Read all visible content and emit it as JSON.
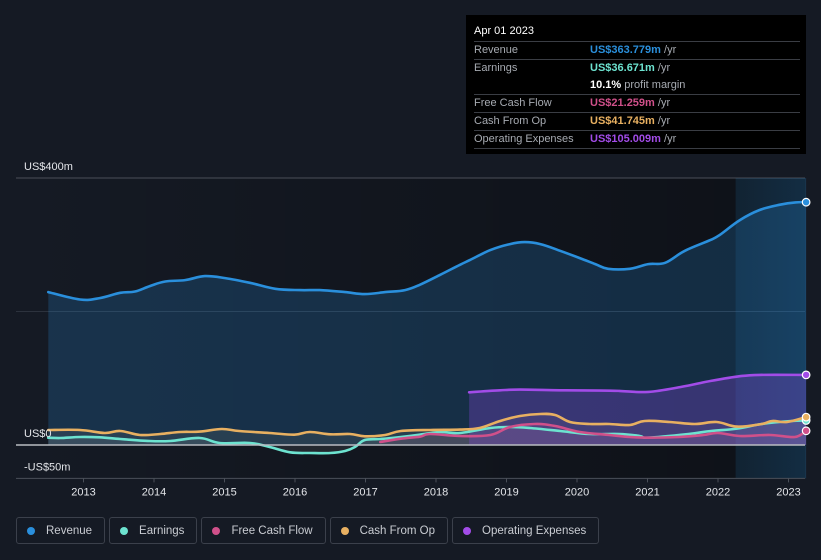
{
  "tooltip": {
    "date": "Apr 01 2023",
    "rows": [
      {
        "label": "Revenue",
        "value": "US$363.779m",
        "unit": "/yr",
        "color": "#2a8fdc"
      },
      {
        "label": "Earnings",
        "value": "US$36.671m",
        "unit": "/yr",
        "color": "#6de3d0"
      },
      {
        "label": "",
        "value": "10.1%",
        "unit": "profit margin",
        "color": "#ffffff"
      },
      {
        "label": "Free Cash Flow",
        "value": "US$21.259m",
        "unit": "/yr",
        "color": "#d0508a"
      },
      {
        "label": "Cash From Op",
        "value": "US$41.745m",
        "unit": "/yr",
        "color": "#e8b061"
      },
      {
        "label": "Operating Expenses",
        "value": "US$105.009m",
        "unit": "/yr",
        "color": "#a24ce8"
      }
    ]
  },
  "legend": [
    {
      "label": "Revenue",
      "color": "#2a8fdc"
    },
    {
      "label": "Earnings",
      "color": "#6de3d0"
    },
    {
      "label": "Free Cash Flow",
      "color": "#d0508a"
    },
    {
      "label": "Cash From Op",
      "color": "#e8b061"
    },
    {
      "label": "Operating Expenses",
      "color": "#a24ce8"
    }
  ],
  "chart_data": {
    "type": "area",
    "title": "",
    "xlabel": "",
    "ylabel": "",
    "ylim": [
      -50,
      400
    ],
    "xlim": [
      2012.3,
      2023.25
    ],
    "y_tick_labels": [
      {
        "value": 400,
        "label": "US$400m"
      },
      {
        "value": 0,
        "label": "US$0"
      },
      {
        "value": -50,
        "label": "-US$50m"
      }
    ],
    "gridlines_at": [
      400,
      200
    ],
    "x_ticks": [
      2013,
      2014,
      2015,
      2016,
      2017,
      2018,
      2019,
      2020,
      2021,
      2022,
      2023
    ],
    "x_tick_labels": [
      "2013",
      "2014",
      "2015",
      "2016",
      "2017",
      "2018",
      "2019",
      "2020",
      "2021",
      "2022",
      "2023"
    ],
    "highlight_range": [
      2022.25,
      2023.25
    ],
    "legend_position": "bottom-left",
    "units": "US$ millions per year",
    "series": [
      {
        "name": "Revenue",
        "color": "#2a8fdc",
        "points": [
          [
            2012.5,
            229
          ],
          [
            2012.95,
            218
          ],
          [
            2013.23,
            220
          ],
          [
            2013.52,
            228
          ],
          [
            2013.73,
            230
          ],
          [
            2013.94,
            238
          ],
          [
            2014.16,
            245
          ],
          [
            2014.44,
            247
          ],
          [
            2014.72,
            253
          ],
          [
            2015.01,
            250
          ],
          [
            2015.36,
            243
          ],
          [
            2015.72,
            234
          ],
          [
            2016.07,
            232
          ],
          [
            2016.35,
            232
          ],
          [
            2016.71,
            229
          ],
          [
            2016.99,
            226
          ],
          [
            2017.28,
            229
          ],
          [
            2017.56,
            232
          ],
          [
            2017.77,
            240
          ],
          [
            2018.06,
            255
          ],
          [
            2018.34,
            270
          ],
          [
            2018.48,
            277
          ],
          [
            2018.77,
            292
          ],
          [
            2019.05,
            301
          ],
          [
            2019.26,
            304
          ],
          [
            2019.48,
            301
          ],
          [
            2019.76,
            291
          ],
          [
            2020.04,
            280
          ],
          [
            2020.26,
            271
          ],
          [
            2020.44,
            264
          ],
          [
            2020.75,
            264
          ],
          [
            2021.01,
            271
          ],
          [
            2021.25,
            273
          ],
          [
            2021.53,
            291
          ],
          [
            2021.89,
            307
          ],
          [
            2022.03,
            315
          ],
          [
            2022.31,
            337
          ],
          [
            2022.59,
            352
          ],
          [
            2022.88,
            360
          ],
          [
            2023.1,
            363.5
          ],
          [
            2023.25,
            363.779
          ]
        ]
      },
      {
        "name": "Earnings",
        "color": "#6de3d0",
        "points": [
          [
            2012.5,
            11
          ],
          [
            2012.67,
            10.5
          ],
          [
            2012.95,
            12
          ],
          [
            2013.23,
            11.5
          ],
          [
            2013.52,
            9
          ],
          [
            2013.94,
            6
          ],
          [
            2014.23,
            6
          ],
          [
            2014.65,
            10.5
          ],
          [
            2014.93,
            3
          ],
          [
            2015.36,
            3
          ],
          [
            2015.64,
            -3
          ],
          [
            2015.93,
            -11
          ],
          [
            2016.21,
            -12
          ],
          [
            2016.5,
            -12
          ],
          [
            2016.71,
            -9
          ],
          [
            2016.85,
            -3
          ],
          [
            2016.99,
            7.5
          ],
          [
            2017.21,
            9
          ],
          [
            2017.5,
            12
          ],
          [
            2017.77,
            15.5
          ],
          [
            2018.06,
            19.5
          ],
          [
            2018.34,
            18
          ],
          [
            2018.77,
            25.5
          ],
          [
            2019.05,
            27
          ],
          [
            2019.33,
            25.5
          ],
          [
            2019.76,
            21
          ],
          [
            2020.18,
            16.5
          ],
          [
            2020.6,
            16.5
          ],
          [
            2020.89,
            13.5
          ],
          [
            2021.01,
            11
          ],
          [
            2021.58,
            16.5
          ],
          [
            2021.9,
            21
          ],
          [
            2022.27,
            24.5
          ],
          [
            2022.62,
            31.5
          ],
          [
            2023.04,
            36
          ],
          [
            2023.25,
            36.671
          ]
        ]
      },
      {
        "name": "Free Cash Flow",
        "color": "#d0508a",
        "points": [
          [
            2017.21,
            4.5
          ],
          [
            2017.5,
            9.5
          ],
          [
            2017.77,
            12.5
          ],
          [
            2017.92,
            16.5
          ],
          [
            2018.34,
            13.5
          ],
          [
            2018.77,
            15
          ],
          [
            2019.05,
            27
          ],
          [
            2019.4,
            31.5
          ],
          [
            2019.69,
            28.5
          ],
          [
            2020.04,
            19.5
          ],
          [
            2020.46,
            15
          ],
          [
            2020.75,
            12
          ],
          [
            2021.01,
            11
          ],
          [
            2021.44,
            12
          ],
          [
            2021.79,
            15
          ],
          [
            2022.0,
            18
          ],
          [
            2022.31,
            13.5
          ],
          [
            2022.74,
            15
          ],
          [
            2023.09,
            12
          ],
          [
            2023.25,
            21.259
          ]
        ]
      },
      {
        "name": "Cash From Op",
        "color": "#e8b061",
        "points": [
          [
            2012.5,
            22.5
          ],
          [
            2012.95,
            22.5
          ],
          [
            2013.3,
            18
          ],
          [
            2013.52,
            21
          ],
          [
            2013.8,
            15
          ],
          [
            2014.09,
            16.5
          ],
          [
            2014.37,
            19.5
          ],
          [
            2014.65,
            20
          ],
          [
            2014.96,
            24
          ],
          [
            2015.21,
            21
          ],
          [
            2015.64,
            18
          ],
          [
            2015.99,
            15.5
          ],
          [
            2016.21,
            19.5
          ],
          [
            2016.5,
            16
          ],
          [
            2016.78,
            16.5
          ],
          [
            2016.99,
            13
          ],
          [
            2017.28,
            15
          ],
          [
            2017.5,
            21
          ],
          [
            2017.92,
            22.5
          ],
          [
            2018.34,
            23
          ],
          [
            2018.62,
            25.5
          ],
          [
            2018.91,
            36
          ],
          [
            2019.19,
            43.5
          ],
          [
            2019.48,
            46.5
          ],
          [
            2019.69,
            45
          ],
          [
            2019.9,
            34.5
          ],
          [
            2020.18,
            31.5
          ],
          [
            2020.46,
            31.5
          ],
          [
            2020.75,
            30
          ],
          [
            2020.96,
            36
          ],
          [
            2021.31,
            34.5
          ],
          [
            2021.67,
            31.5
          ],
          [
            2021.98,
            34.5
          ],
          [
            2022.27,
            27.5
          ],
          [
            2022.62,
            31.5
          ],
          [
            2022.77,
            36
          ],
          [
            2022.98,
            34.5
          ],
          [
            2023.25,
            41.745
          ]
        ]
      },
      {
        "name": "Operating Expenses",
        "color": "#a24ce8",
        "points": [
          [
            2018.47,
            79
          ],
          [
            2018.91,
            82
          ],
          [
            2019.19,
            83
          ],
          [
            2019.76,
            82
          ],
          [
            2020.33,
            81.5
          ],
          [
            2020.6,
            81
          ],
          [
            2021.01,
            79.5
          ],
          [
            2021.48,
            87
          ],
          [
            2021.9,
            96
          ],
          [
            2022.31,
            103
          ],
          [
            2022.59,
            105
          ],
          [
            2023.25,
            105.009
          ]
        ]
      }
    ]
  }
}
